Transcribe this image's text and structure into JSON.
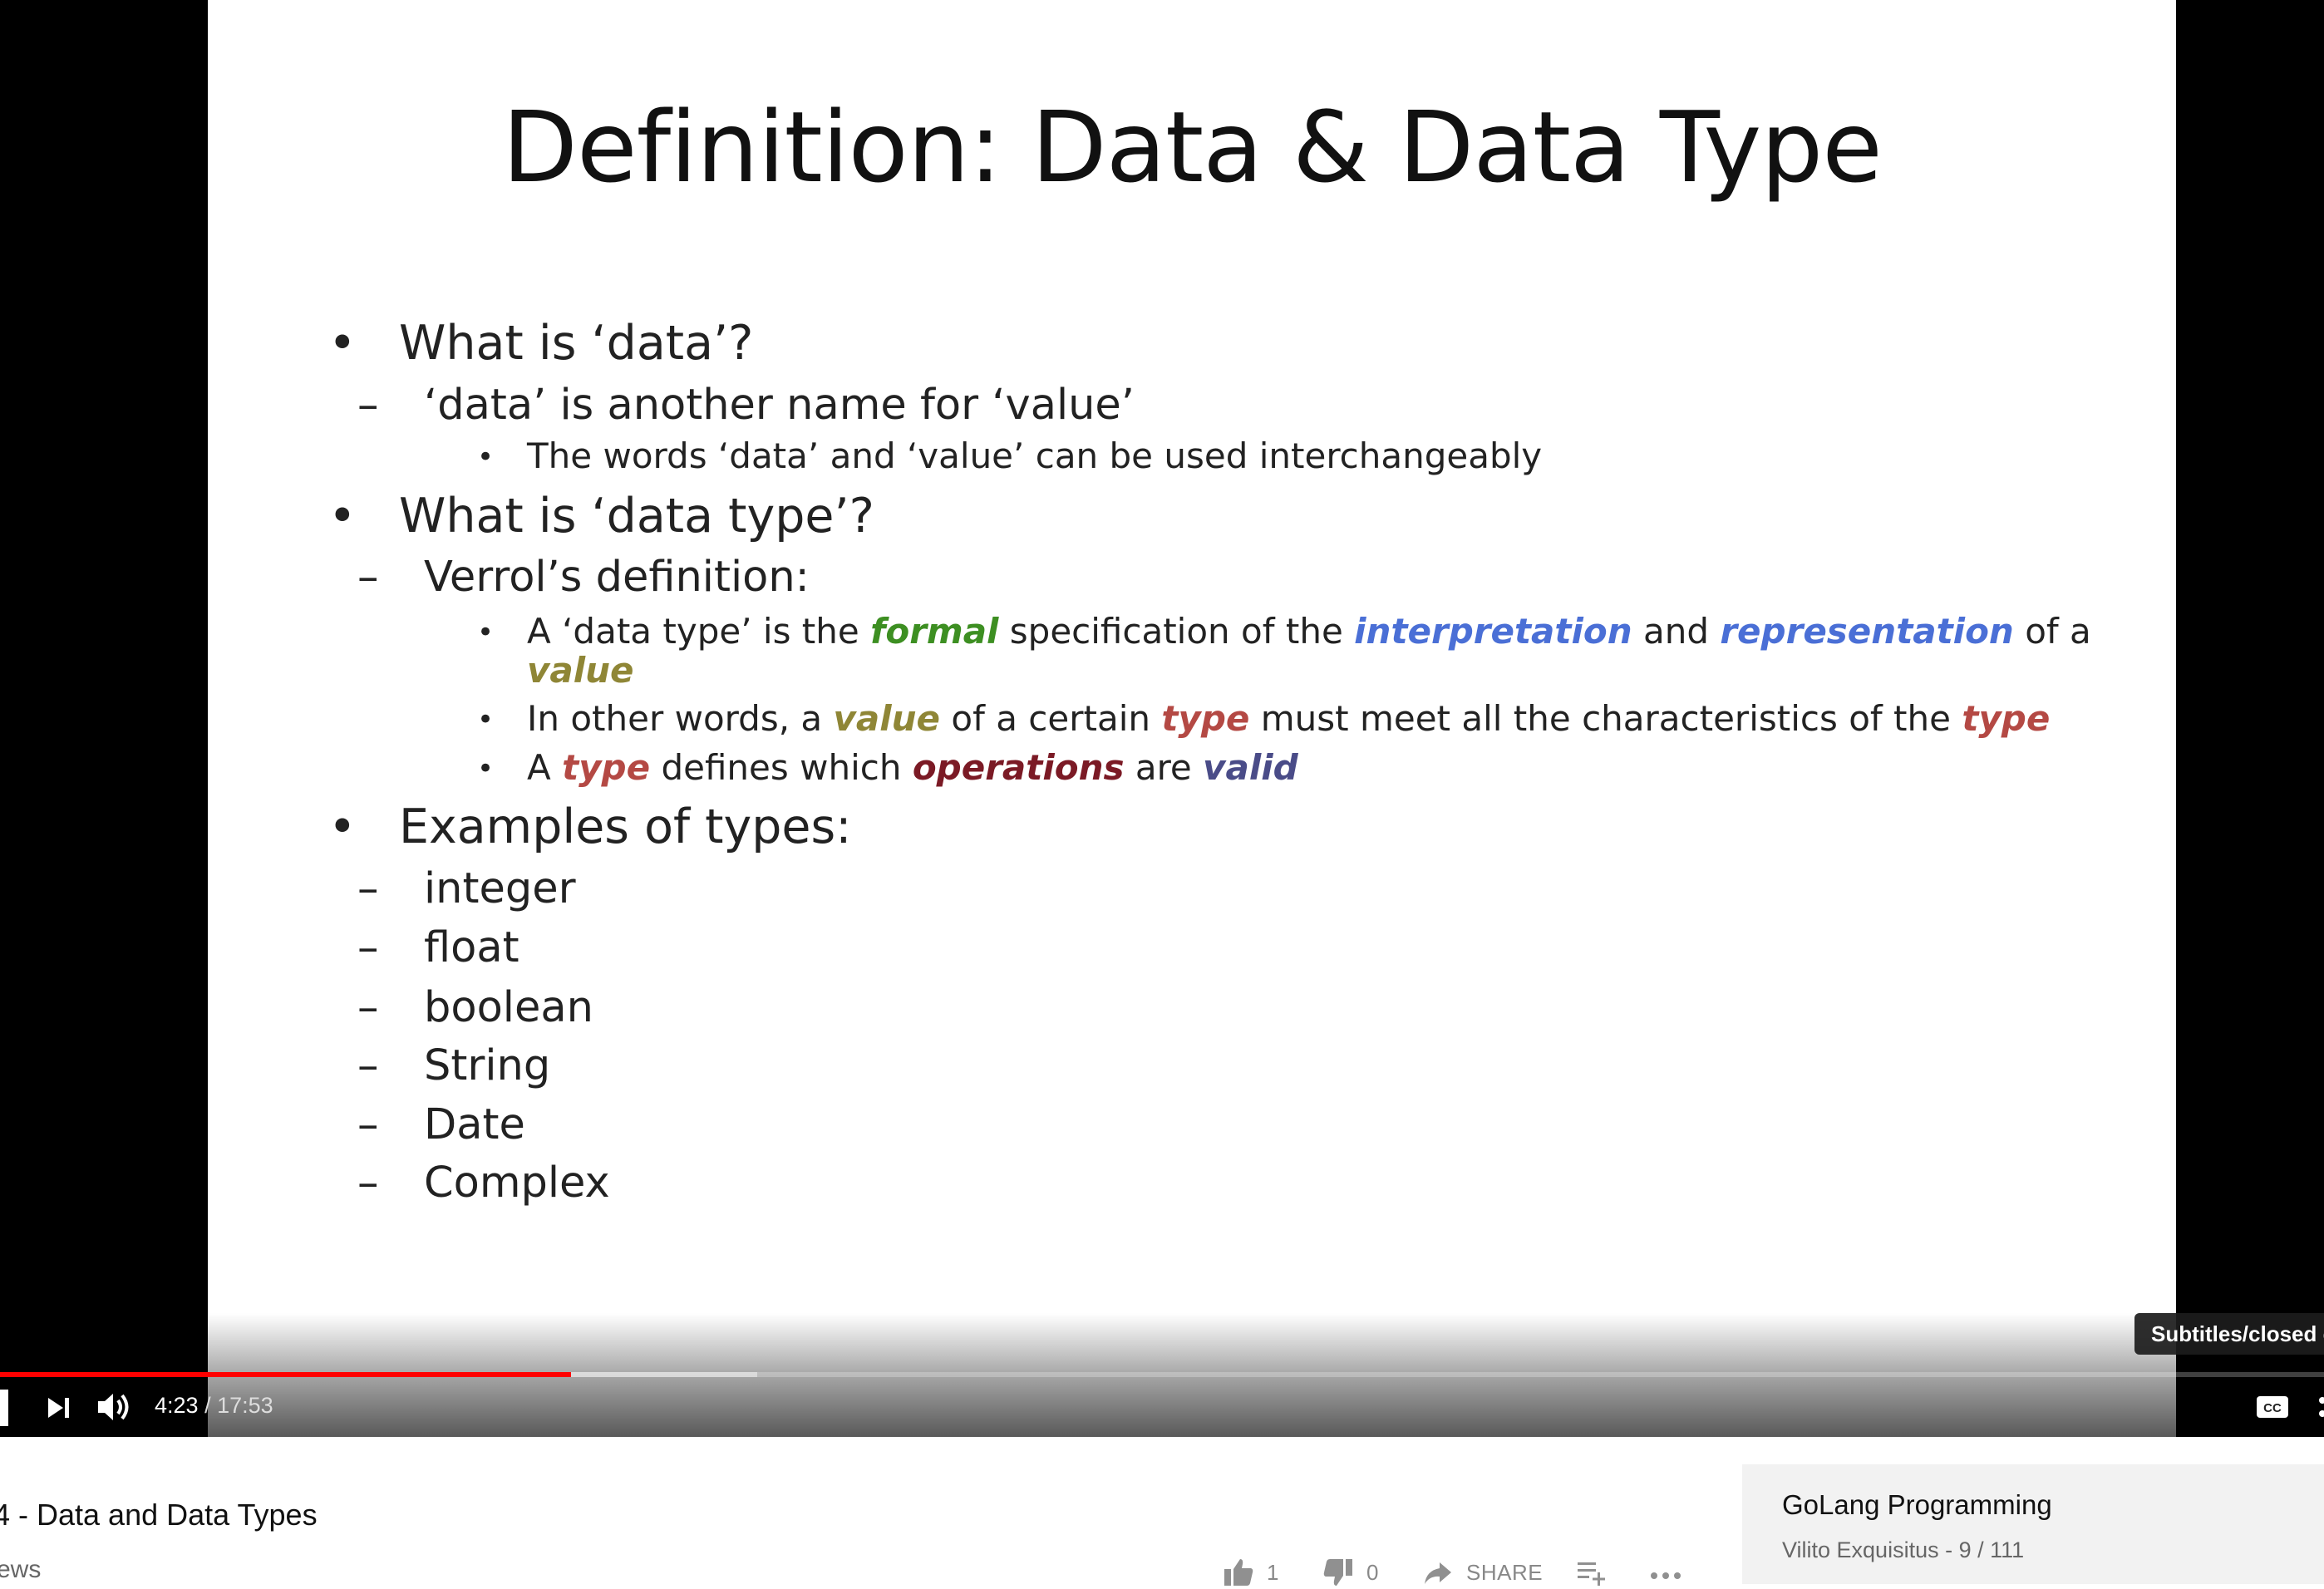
{
  "slide": {
    "title": "Definition: Data & Data Type",
    "bullet_marker": "•",
    "dash_marker": "–",
    "items": {
      "q1": "What is  ‘data’?",
      "q1_answer": "‘data’ is another name for ‘value’",
      "q1_note": "The words ‘data’ and ‘value’ can be used interchangeably",
      "q2": "What is ‘data type’?",
      "q2_sub": "Verrol’s definition:",
      "def1": {
        "p1": "A ‘data type’ is the ",
        "formal": "formal",
        "p2": " specification of the ",
        "interpretation": "interpretation",
        "p3": " and ",
        "representation": "representation",
        "p4": " of a",
        "value": "value"
      },
      "def2": {
        "p1": "In other words, a ",
        "value": "value",
        "p2": " of a certain ",
        "type1": "type",
        "p3": " must meet all the characteristics of the ",
        "type2": "type"
      },
      "def3": {
        "p1": "A ",
        "type": "type",
        "p2": " defines which ",
        "operations": "operations",
        "p3": " are ",
        "valid": "valid"
      },
      "q3": "Examples of types:",
      "examples": [
        "integer",
        "float",
        "boolean",
        "String",
        "Date",
        "Complex"
      ]
    }
  },
  "player": {
    "current_time": "4:23",
    "separator": " / ",
    "duration": "17:53",
    "progress_played": 0.2458,
    "progress_buffered": 0.326,
    "tooltip": "Subtitles/closed captions (c)",
    "icons": {
      "play": "play-icon",
      "next": "next-icon",
      "volume": "volume-icon",
      "captions": "cc-icon",
      "settings": "settings-icon"
    },
    "accent_color": "#ff0000"
  },
  "video": {
    "title": "4 - Data and Data Types",
    "views": "ews"
  },
  "actions": {
    "likes": "1",
    "dislikes": "0",
    "share_label": "SHARE"
  },
  "playlist": {
    "title": "GoLang Programming",
    "meta": "Vilito Exquisitus - 9 / 111"
  }
}
